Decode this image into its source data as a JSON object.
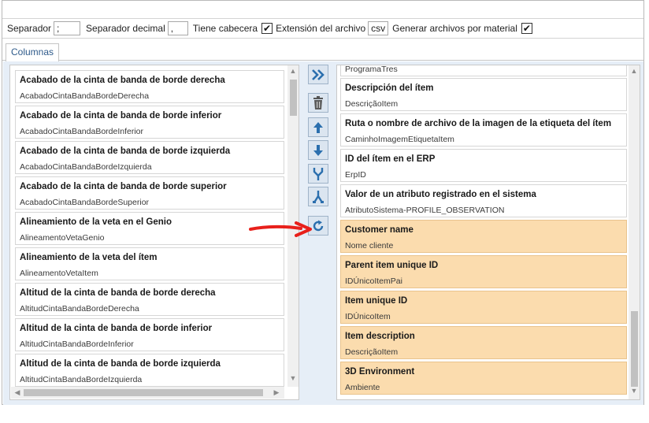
{
  "toolbar": {
    "separator_label": "Separador",
    "separator_value": ";",
    "decimal_label": "Separador decimal",
    "decimal_value": ",",
    "header_label": "Tiene cabecera",
    "header_checked": true,
    "extension_label": "Extensión del archivo",
    "extension_value": "csv",
    "per_material_label": "Generar archivos por material",
    "per_material_checked": true
  },
  "tabs": [
    {
      "label": "Columnas",
      "active": true
    }
  ],
  "left_list": {
    "items": [
      {
        "title": "Acabado de la cinta de banda de borde derecha",
        "field": "AcabadoCintaBandaBordeDerecha"
      },
      {
        "title": "Acabado de la cinta de banda de borde inferior",
        "field": "AcabadoCintaBandaBordeInferior"
      },
      {
        "title": "Acabado de la cinta de banda de borde izquierda",
        "field": "AcabadoCintaBandaBordeIzquierda"
      },
      {
        "title": "Acabado de la cinta de banda de borde superior",
        "field": "AcabadoCintaBandaBordeSuperior"
      },
      {
        "title": "Alineamiento de la veta en el Genio",
        "field": "AlineamentoVetaGenio"
      },
      {
        "title": "Alineamiento de la veta del ítem",
        "field": "AlineamentoVetaItem"
      },
      {
        "title": "Altitud de la cinta de banda de borde derecha",
        "field": "AltitudCintaBandaBordeDerecha"
      },
      {
        "title": "Altitud de la cinta de banda de borde inferior",
        "field": "AltitudCintaBandaBordeInferior"
      },
      {
        "title": "Altitud de la cinta de banda de borde izquierda",
        "field": "AltitudCintaBandaBordeIzquierda"
      }
    ]
  },
  "tools": [
    {
      "name": "add-all-button",
      "icon": "double-chevron-right-icon"
    },
    {
      "name": "delete-button",
      "icon": "trash-icon"
    },
    {
      "name": "move-up-button",
      "icon": "arrow-up-icon"
    },
    {
      "name": "move-down-button",
      "icon": "arrow-down-icon"
    },
    {
      "name": "merge-button",
      "icon": "merge-icon"
    },
    {
      "name": "split-button",
      "icon": "split-icon"
    },
    {
      "name": "refresh-button",
      "icon": "refresh-icon"
    }
  ],
  "right_list": {
    "partial_top_field": "ProgramaTres",
    "items": [
      {
        "title": "Descripción del ítem",
        "field": "DescriçãoItem",
        "custom": false
      },
      {
        "title": "Ruta o nombre de archivo de la imagen de la etiqueta del ítem",
        "field": "CaminhoImagemEtiquetaItem",
        "custom": false
      },
      {
        "title": "ID del ítem en el ERP",
        "field": "ErpID",
        "custom": false
      },
      {
        "title": "Valor de un atributo registrado en el sistema",
        "field": "AtributoSistema-PROFILE_OBSERVATION",
        "custom": false
      },
      {
        "title": "Customer name",
        "field": "Nome cliente",
        "custom": true
      },
      {
        "title": "Parent item unique ID",
        "field": "IDÚnicoItemPai",
        "custom": true
      },
      {
        "title": "Item unique ID",
        "field": "IDÚnicoItem",
        "custom": true
      },
      {
        "title": "Item description",
        "field": "DescriçãoItem",
        "custom": true
      },
      {
        "title": "3D Environment",
        "field": "Ambiente",
        "custom": true
      }
    ]
  },
  "colors": {
    "custom_item_bg": "#fbdcae",
    "content_bg": "#e6eef7",
    "annotation_arrow": "#e8201b",
    "tool_icon": "#2b6fae"
  }
}
